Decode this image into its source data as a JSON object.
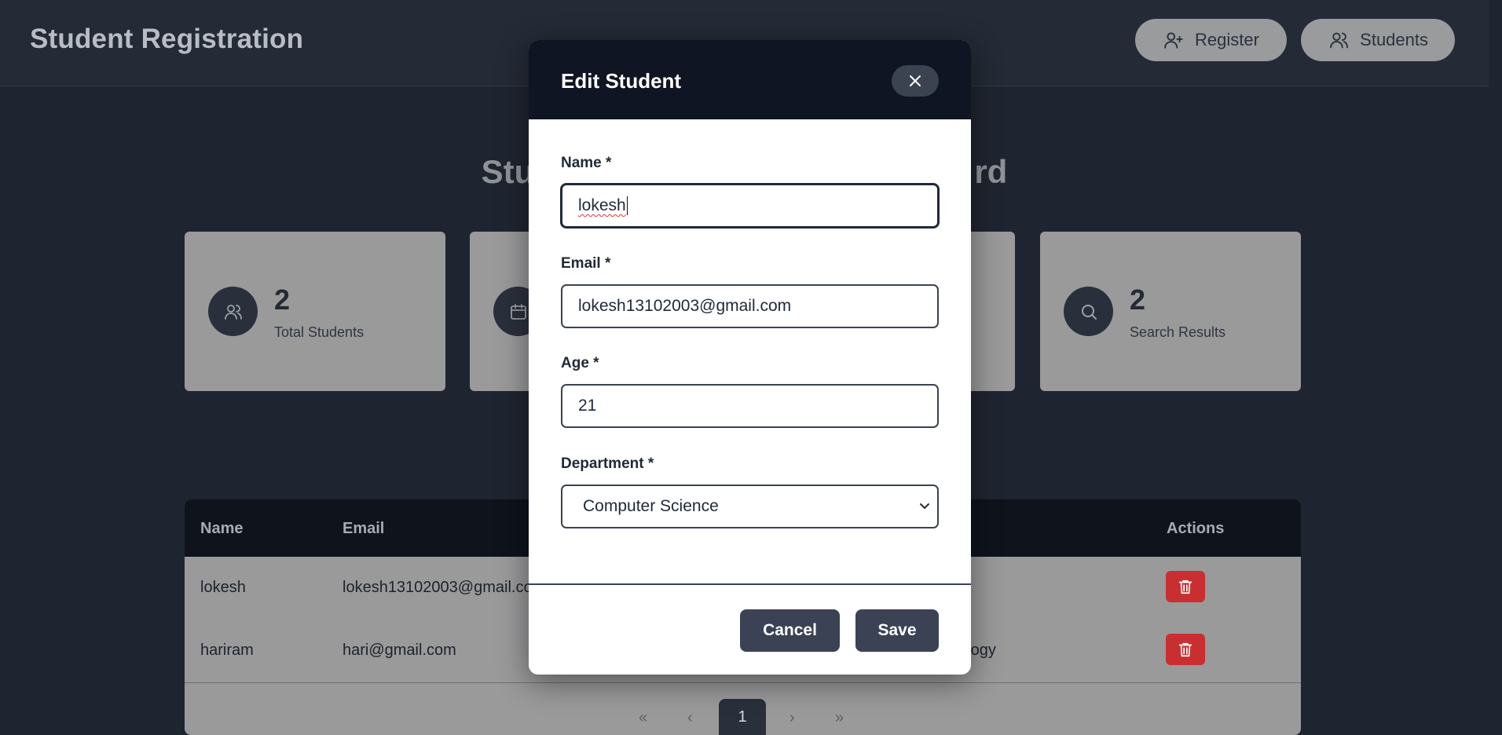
{
  "header": {
    "brand": "Student Registration",
    "nav": [
      {
        "label": "Register",
        "icon": "user-plus-icon"
      },
      {
        "label": "Students",
        "icon": "users-icon"
      }
    ]
  },
  "dashboard": {
    "title_left": "Stu",
    "title_right": "rd",
    "cards": [
      {
        "value": "2",
        "label": "Total Students",
        "icon": "users-icon"
      },
      {
        "value": "",
        "label": "",
        "icon": "calendar-icon"
      },
      {
        "value": "",
        "label": "",
        "icon": ""
      },
      {
        "value": "2",
        "label": "Search Results",
        "icon": "search-icon"
      }
    ]
  },
  "table": {
    "headers": {
      "name": "Name",
      "email": "Email",
      "actions": "Actions"
    },
    "rows": [
      {
        "name": "lokesh",
        "email": "lokesh13102003@gmail.co",
        "extra": ""
      },
      {
        "name": "hariram",
        "email": "hari@gmail.com",
        "extra": "ology"
      }
    ],
    "pager": {
      "first": "«",
      "prev": "‹",
      "current": "1",
      "next": "›",
      "last": "»"
    }
  },
  "modal": {
    "title": "Edit Student",
    "fields": {
      "name": {
        "label": "Name *",
        "value": "lokesh"
      },
      "email": {
        "label": "Email *",
        "value": "lokesh13102003@gmail.com"
      },
      "age": {
        "label": "Age *",
        "value": "21"
      },
      "department": {
        "label": "Department *",
        "value": "Computer Science"
      }
    },
    "cancel_label": "Cancel",
    "save_label": "Save"
  },
  "colors": {
    "modal_header": "#0f1522",
    "button": "#3a4253",
    "delete": "#c92f31",
    "card": "#9a9a9b"
  }
}
